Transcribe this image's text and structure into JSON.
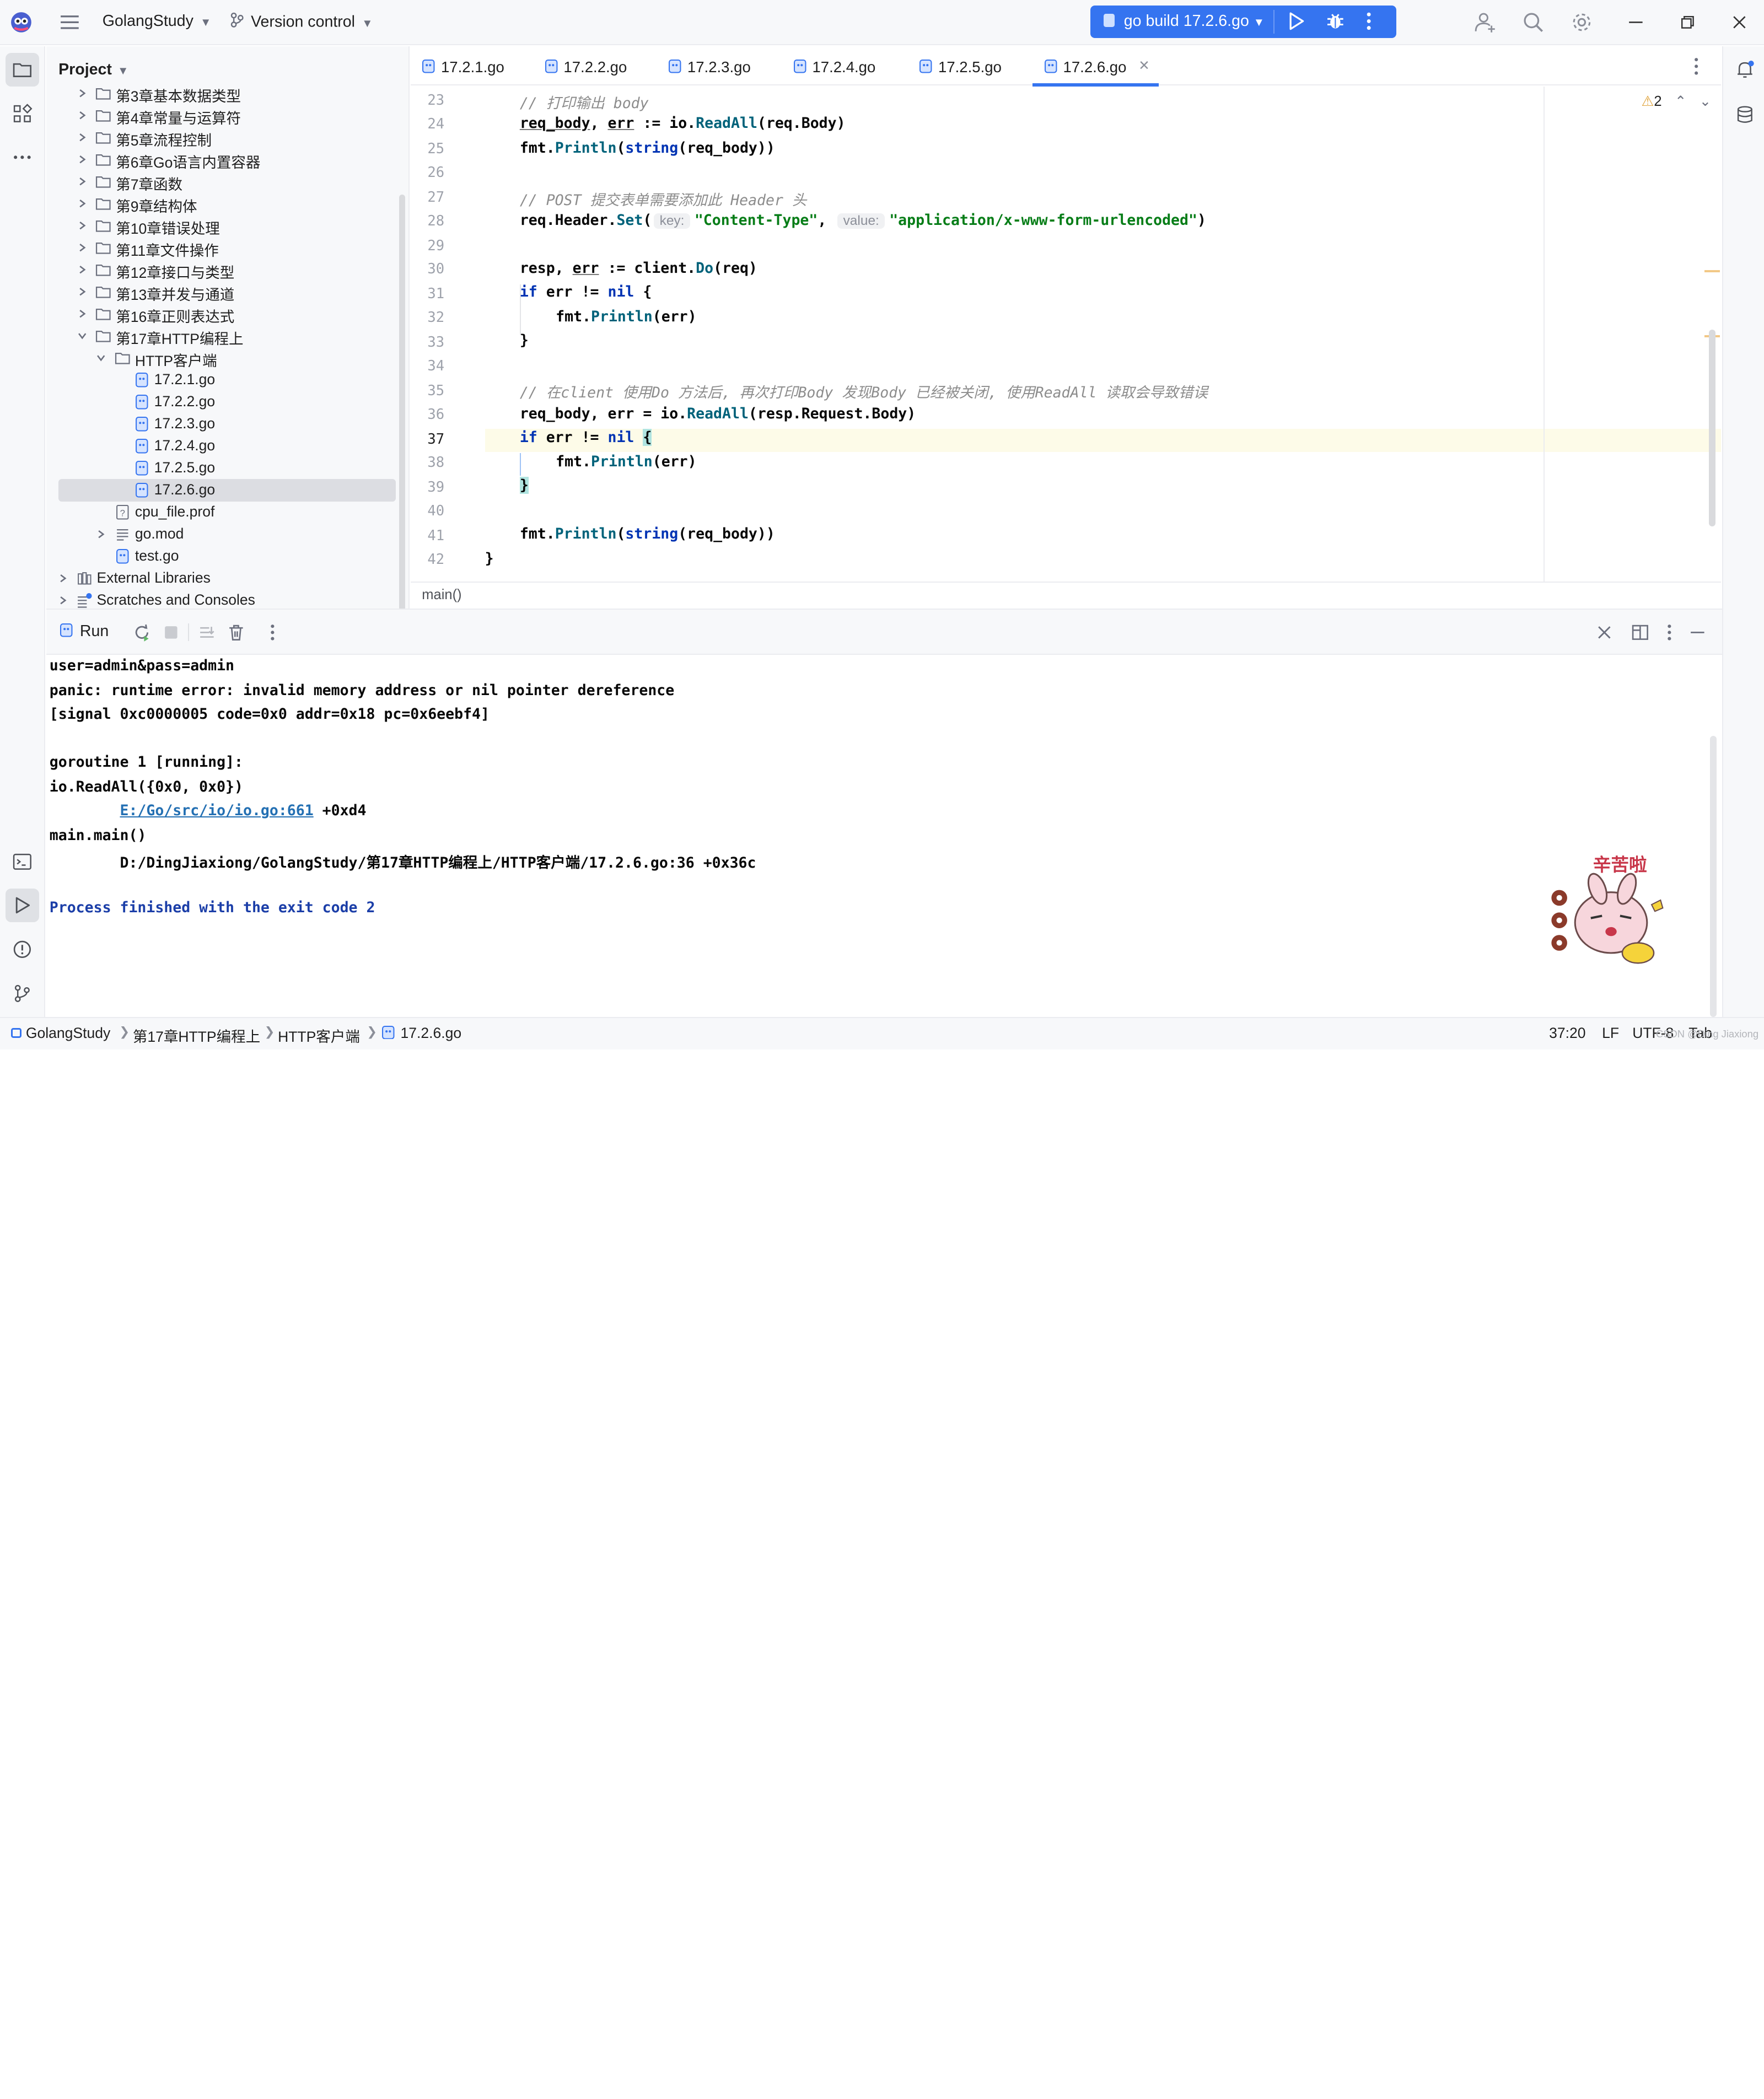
{
  "titlebar": {
    "project_name": "GolangStudy",
    "vcs_label": "Version control",
    "run_config": "go build 17.2.6.go"
  },
  "project_panel": {
    "title": "Project",
    "tree": [
      {
        "label": "第3章基本数据类型",
        "type": "folder",
        "depth": 1,
        "expanded": false
      },
      {
        "label": "第4章常量与运算符",
        "type": "folder",
        "depth": 1,
        "expanded": false
      },
      {
        "label": "第5章流程控制",
        "type": "folder",
        "depth": 1,
        "expanded": false
      },
      {
        "label": "第6章Go语言内置容器",
        "type": "folder",
        "depth": 1,
        "expanded": false
      },
      {
        "label": "第7章函数",
        "type": "folder",
        "depth": 1,
        "expanded": false
      },
      {
        "label": "第9章结构体",
        "type": "folder",
        "depth": 1,
        "expanded": false
      },
      {
        "label": "第10章错误处理",
        "type": "folder",
        "depth": 1,
        "expanded": false
      },
      {
        "label": "第11章文件操作",
        "type": "folder",
        "depth": 1,
        "expanded": false
      },
      {
        "label": "第12章接口与类型",
        "type": "folder",
        "depth": 1,
        "expanded": false
      },
      {
        "label": "第13章并发与通道",
        "type": "folder",
        "depth": 1,
        "expanded": false
      },
      {
        "label": "第16章正则表达式",
        "type": "folder",
        "depth": 1,
        "expanded": false
      },
      {
        "label": "第17章HTTP编程上",
        "type": "folder",
        "depth": 1,
        "expanded": true
      },
      {
        "label": "HTTP客户端",
        "type": "folder",
        "depth": 2,
        "expanded": true
      },
      {
        "label": "17.2.1.go",
        "type": "go",
        "depth": 3
      },
      {
        "label": "17.2.2.go",
        "type": "go",
        "depth": 3
      },
      {
        "label": "17.2.3.go",
        "type": "go",
        "depth": 3
      },
      {
        "label": "17.2.4.go",
        "type": "go",
        "depth": 3
      },
      {
        "label": "17.2.5.go",
        "type": "go",
        "depth": 3
      },
      {
        "label": "17.2.6.go",
        "type": "go",
        "depth": 3,
        "selected": true
      },
      {
        "label": "cpu_file.prof",
        "type": "unknown",
        "depth": 2
      },
      {
        "label": "go.mod",
        "type": "mod",
        "depth": 2,
        "expandable": true
      },
      {
        "label": "test.go",
        "type": "go",
        "depth": 2
      },
      {
        "label": "External Libraries",
        "type": "library",
        "depth": 0,
        "expandable": true
      },
      {
        "label": "Scratches and Consoles",
        "type": "scratch",
        "depth": 0,
        "expandable": true
      }
    ]
  },
  "editor": {
    "tabs": [
      {
        "label": "17.2.1.go"
      },
      {
        "label": "17.2.2.go"
      },
      {
        "label": "17.2.3.go"
      },
      {
        "label": "17.2.4.go"
      },
      {
        "label": "17.2.5.go"
      },
      {
        "label": "17.2.6.go",
        "active": true
      }
    ],
    "line_numbers": [
      "23",
      "24",
      "25",
      "26",
      "27",
      "28",
      "29",
      "30",
      "31",
      "32",
      "33",
      "34",
      "35",
      "36",
      "37",
      "38",
      "39",
      "40",
      "41",
      "42"
    ],
    "current_line": "37",
    "code": {
      "l23_comment": "// 打印输出 body",
      "l24_a": "req_body",
      "l24_b": ", ",
      "l24_c": "err",
      "l24_d": " := ",
      "l24_e": "io",
      "l24_f": ".",
      "l24_g": "ReadAll",
      "l24_h": "(req.Body)",
      "l25_a": "fmt",
      "l25_b": ".",
      "l25_c": "Println",
      "l25_d": "(",
      "l25_e": "string",
      "l25_f": "(req_body))",
      "l27_comment": "// POST 提交表单需要添加此 Header 头",
      "l28_a": "req.Header.",
      "l28_b": "Set",
      "l28_c": "(",
      "l28_hint1": "key:",
      "l28_s1": "\"Content-Type\"",
      "l28_comma": ",",
      "l28_hint2": "value:",
      "l28_s2": "\"application/x-www-form-urlencoded\"",
      "l28_end": ")",
      "l30_a": "resp, ",
      "l30_b": "err",
      "l30_c": " := client.",
      "l30_d": "Do",
      "l30_e": "(req)",
      "l31_a": "if",
      "l31_b": " err != ",
      "l31_c": "nil",
      "l31_d": " {",
      "l32_a": "fmt",
      "l32_b": ".",
      "l32_c": "Println",
      "l32_d": "(err)",
      "l33": "}",
      "l35_comment": "// 在client 使用Do 方法后, 再次打印Body 发现Body 已经被关闭, 使用ReadAll 读取会导致错误",
      "l36_a": "req_body, err = ",
      "l36_b": "io",
      "l36_c": ".",
      "l36_d": "ReadAll",
      "l36_e": "(resp.Request.Body)",
      "l37_a": "if",
      "l37_b": " err != ",
      "l37_c": "nil",
      "l37_d": " ",
      "l37_brace": "{",
      "l38_a": "fmt",
      "l38_b": ".",
      "l38_c": "Println",
      "l38_d": "(err)",
      "l39": "}",
      "l41_a": "fmt",
      "l41_b": ".",
      "l41_c": "Println",
      "l41_d": "(",
      "l41_e": "string",
      "l41_f": "(req_body))",
      "l42": "}"
    },
    "inspection_count": "2",
    "breadcrumb": "main()"
  },
  "run_panel": {
    "title": "Run",
    "console": {
      "line1": "user=admin&pass=admin",
      "line2": "panic: runtime error: invalid memory address or nil pointer dereference",
      "line3": "[signal 0xc0000005 code=0x0 addr=0x18 pc=0x6eebf4]",
      "line5": "goroutine 1 [running]:",
      "line6": "io.ReadAll({0x0, 0x0})",
      "line7_indent": "        ",
      "line7_link": "E:/Go/src/io/io.go:661",
      "line7_rest": " +0xd4",
      "line8": "main.main()",
      "line9": "        D:/DingJiaxiong/GolangStudy/第17章HTTP编程上/HTTP客户端/17.2.6.go:36 +0x36c",
      "line11": "Process finished with the exit code 2"
    },
    "sticker_text": "辛苦啦"
  },
  "status_bar": {
    "crumbs": [
      "GolangStudy",
      "第17章HTTP编程上",
      "HTTP客户端",
      "17.2.6.go"
    ],
    "position": "37:20",
    "line_sep": "LF",
    "encoding": "UTF-8",
    "indent": "Tab",
    "watermark": "CSDN @Ding Jiaxiong"
  },
  "colors": {
    "accent": "#3574f0",
    "keyword": "#0033b3",
    "string": "#067d17",
    "function": "#00627a",
    "comment": "#8c8c8c",
    "link": "#2470b3"
  }
}
